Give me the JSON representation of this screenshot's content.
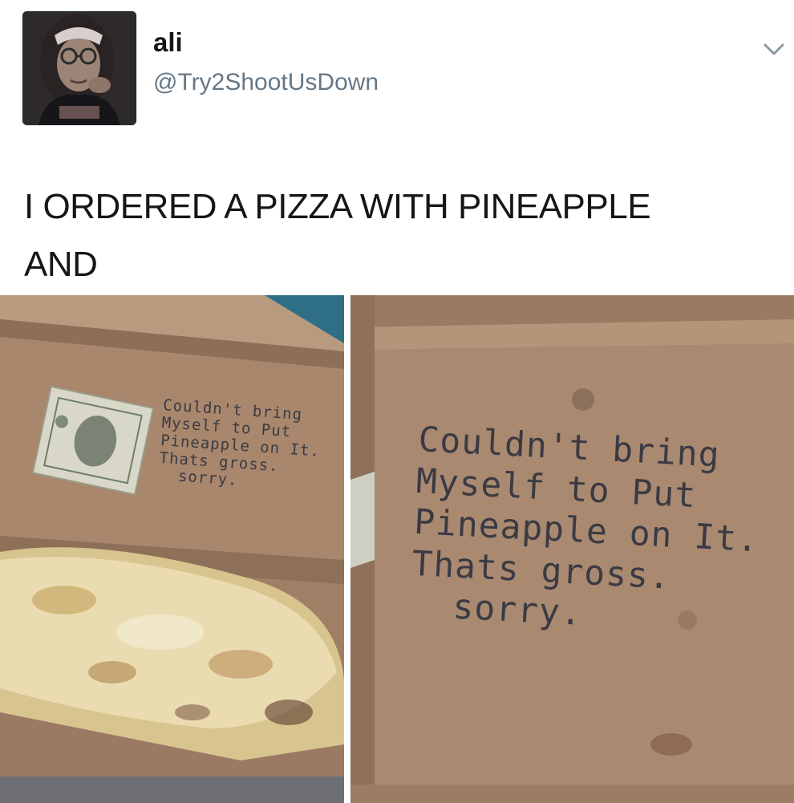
{
  "tweet": {
    "author": {
      "name": "ali",
      "handle": "@Try2ShootUsDown"
    },
    "text": "I ORDERED A PIZZA WITH PINEAPPLE\nAND",
    "menu_icon": "chevron-down-icon"
  },
  "photos": {
    "note_text": "Couldn't bring\nMyself to Put\nPineapple on It.\nThats gross.\n  sorry."
  },
  "colors": {
    "text_primary": "#14171a",
    "text_secondary": "#657786",
    "cardboard": "#a6836a",
    "ink": "#3b3a44"
  }
}
